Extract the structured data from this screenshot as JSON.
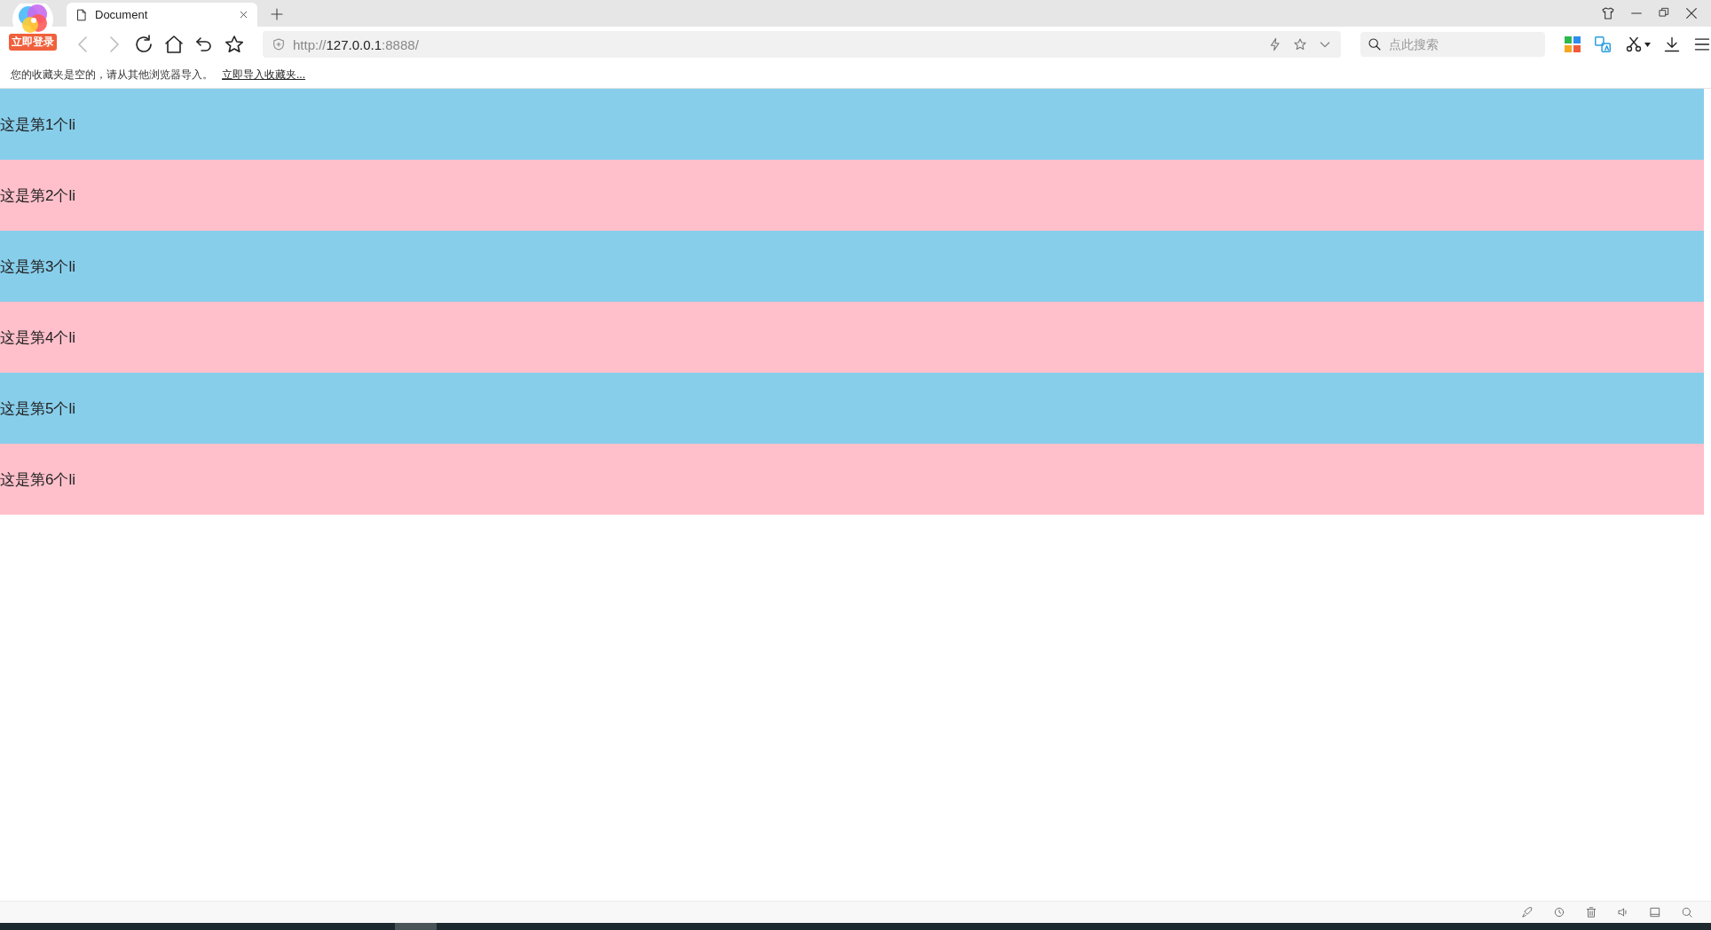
{
  "tab": {
    "title": "Document"
  },
  "login_badge": "立即登录",
  "address_bar": {
    "scheme": "http://",
    "host": "127.0.0.1",
    "port": ":8888/"
  },
  "search": {
    "placeholder": "点此搜索"
  },
  "bookmarks_bar": {
    "message": "您的收藏夹是空的，请从其他浏览器导入。",
    "link": "立即导入收藏夹..."
  },
  "list_items": [
    {
      "text": "这是第1个li",
      "color": "#87ceeb"
    },
    {
      "text": "这是第2个li",
      "color": "#ffc0cb"
    },
    {
      "text": "这是第3个li",
      "color": "#87ceeb"
    },
    {
      "text": "这是第4个li",
      "color": "#ffc0cb"
    },
    {
      "text": "这是第5个li",
      "color": "#87ceeb"
    },
    {
      "text": "这是第6个li",
      "color": "#ffc0cb"
    }
  ]
}
